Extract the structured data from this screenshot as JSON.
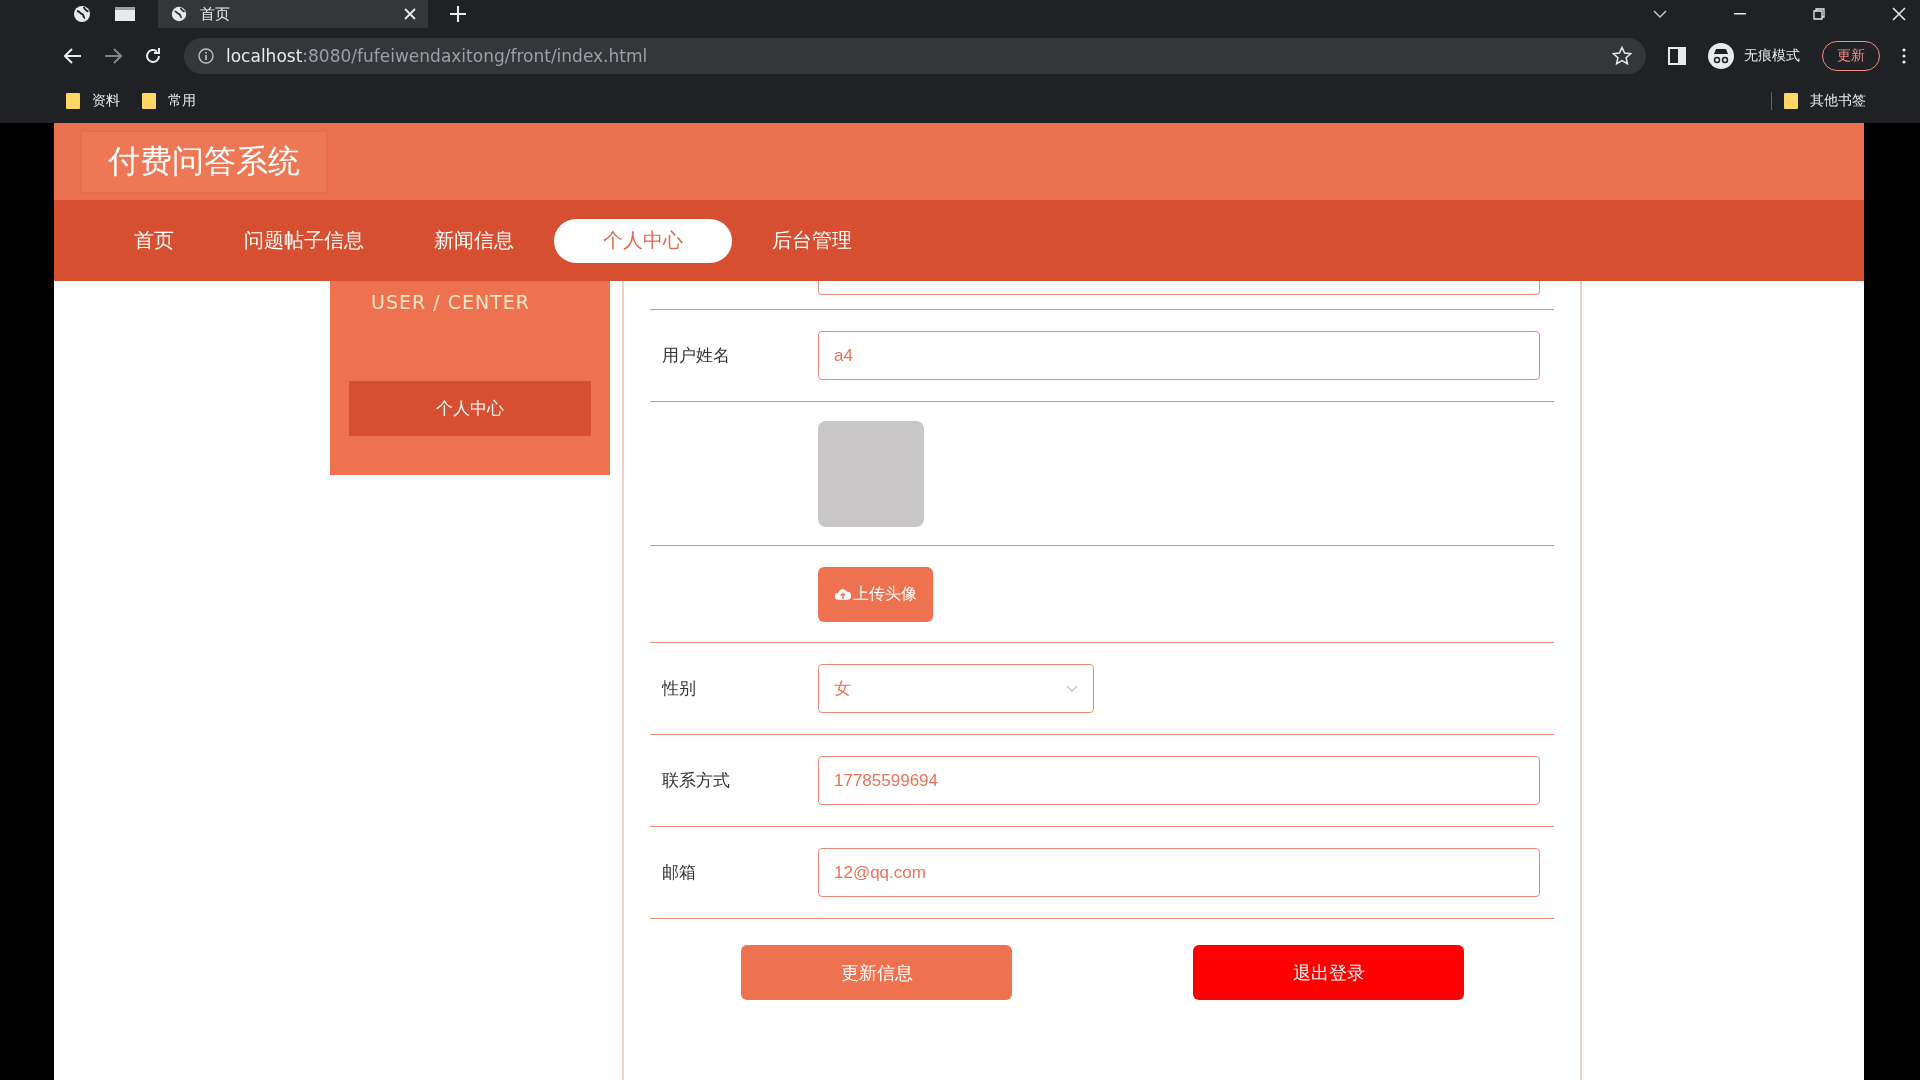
{
  "browser": {
    "tab_title": "首页",
    "url_host": "localhost",
    "url_rest": ":8080/fufeiwendaxitong/front/index.html",
    "incognito_label": "无痕模式",
    "update_button": "更新",
    "bookmarks": [
      "资料",
      "常用"
    ],
    "other_bookmarks": "其他书签"
  },
  "site": {
    "title": "付费问答系统",
    "nav": [
      {
        "label": "首页",
        "selected": false
      },
      {
        "label": "问题帖子信息",
        "selected": false
      },
      {
        "label": "新闻信息",
        "selected": false
      },
      {
        "label": "个人中心",
        "selected": true
      },
      {
        "label": "后台管理",
        "selected": false
      }
    ],
    "sidebar": {
      "heading": "USER / CENTER",
      "items": [
        {
          "label": "个人中心",
          "selected": true
        }
      ]
    }
  },
  "form": {
    "rows": [
      {
        "kind": "input",
        "label": "用户姓名",
        "value": "a4"
      },
      {
        "kind": "avatar"
      },
      {
        "kind": "upload",
        "button": "上传头像"
      },
      {
        "kind": "select",
        "label": "性别",
        "value": "女"
      },
      {
        "kind": "input",
        "label": "联系方式",
        "value": "17785599694"
      },
      {
        "kind": "input",
        "label": "邮箱",
        "value": "12@qq.com"
      }
    ],
    "buttons": [
      {
        "kind": "primary",
        "label": "更新信息"
      },
      {
        "kind": "danger",
        "label": "退出登录"
      }
    ]
  }
}
